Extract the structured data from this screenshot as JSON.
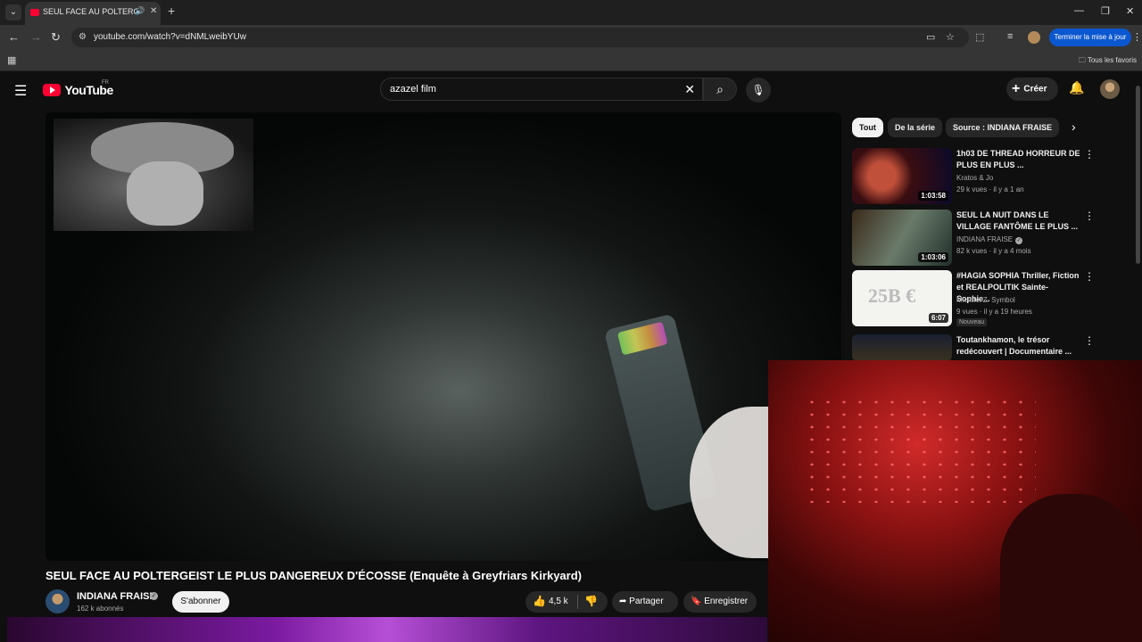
{
  "browser": {
    "tab_title": "SEUL FACE AU POLTERGEIST",
    "url": "youtube.com/watch?v=dNMLweibYUw",
    "update_label": "Terminer la mise à jour",
    "bookmarks_folder": "Tous les favoris"
  },
  "header": {
    "logo_text": "YouTube",
    "region": "FR",
    "search_query": "azazel film",
    "create_label": "Créer"
  },
  "video": {
    "title": "SEUL FACE AU POLTERGEIST LE PLUS DANGEREUX D'ÉCOSSE (Enquête à Greyfriars Kirkyard)",
    "channel": "INDIANA FRAISE",
    "subscribers": "162 k abonnés",
    "subscribe_label": "S'abonner",
    "likes": "4,5 k",
    "share_label": "Partager",
    "save_label": "Enregistrer"
  },
  "chips": [
    "Tout",
    "De la série",
    "Source : INDIANA FRAISE"
  ],
  "recommendations": [
    {
      "title": "1h03 DE THREAD HORREUR DE PLUS EN PLUS ...",
      "channel": "Kratos & Jo",
      "meta": "29 k vues · il y a 1 an",
      "duration": "1:03:58",
      "verified": false,
      "badge": ""
    },
    {
      "title": "SEUL LA NUIT DANS LE VILLAGE FANTÔME LE PLUS ...",
      "channel": "INDIANA FRAISE",
      "meta": "82 k vues · il y a 4 mois",
      "duration": "1:03:06",
      "verified": true,
      "badge": ""
    },
    {
      "title": "#HAGIA SOPHIA Thriller, Fiction et REALPOLITIK Sainte-Sophie...",
      "channel": "Michael Z. Symbol",
      "meta": "9 vues · il y a 19 heures",
      "duration": "6:07",
      "verified": false,
      "badge": "Nouveau"
    },
    {
      "title": "Toutankhamon, le trésor redécouvert | Documentaire ...",
      "channel": "",
      "meta": "",
      "duration": "",
      "verified": false,
      "badge": ""
    }
  ],
  "colors": {
    "brand_red": "#ff0033",
    "background": "#0f0f0f",
    "update_blue": "#0b57d0"
  }
}
